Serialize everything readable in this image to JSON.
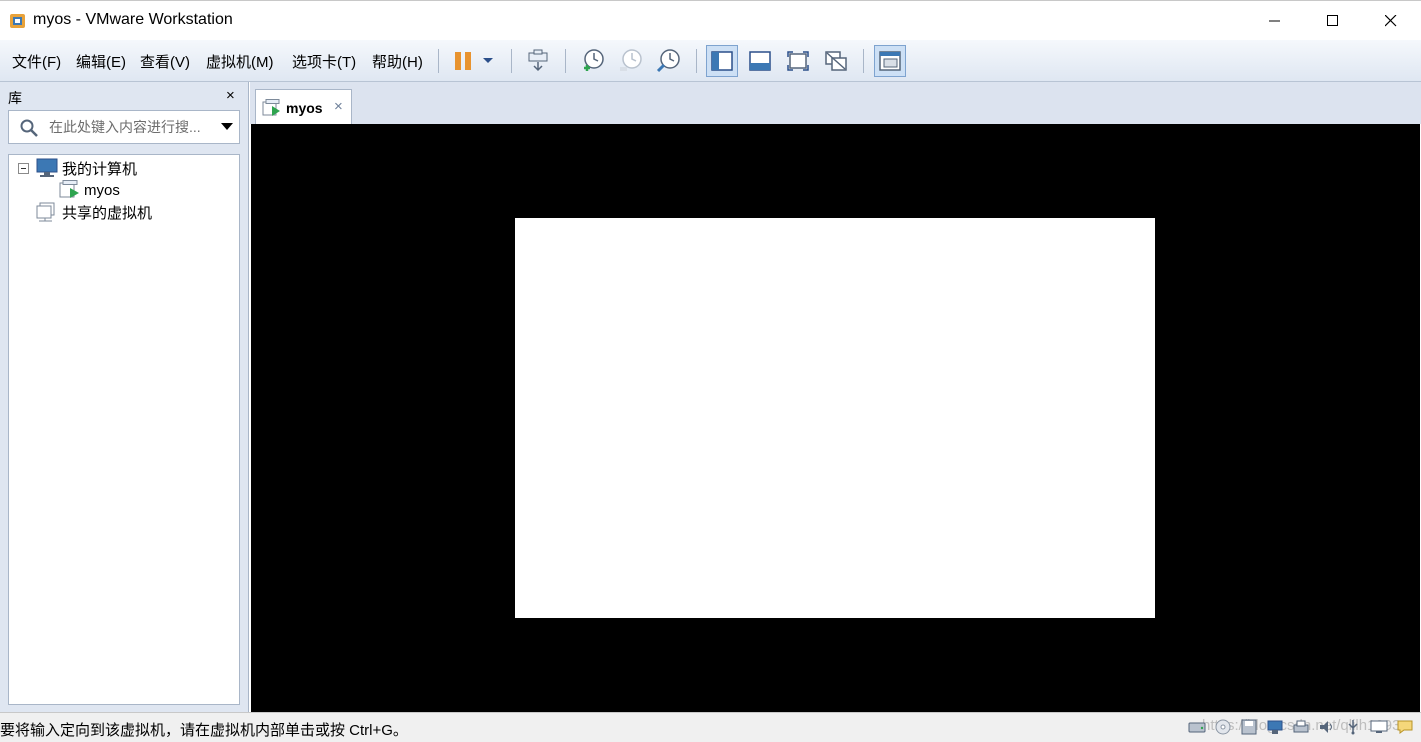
{
  "window": {
    "title": "myos - VMware Workstation",
    "minimize_icon": "minimize-icon",
    "maximize_icon": "maximize-icon",
    "close_icon": "close-icon"
  },
  "menu": {
    "items": [
      "文件(F)",
      "编辑(E)",
      "查看(V)",
      "虚拟机(M)",
      "选项卡(T)",
      "帮助(H)"
    ]
  },
  "toolbar": {
    "icons": [
      "pause-icon",
      "dropdown-arrow-icon",
      "send-ctrl-alt-del-icon",
      "take-snapshot-icon",
      "revert-snapshot-icon",
      "snapshot-manager-icon",
      "show-library-icon",
      "show-thumbnail-icon",
      "full-screen-icon",
      "unity-icon",
      "console-view-icon"
    ]
  },
  "library": {
    "title": "库",
    "close": "×",
    "search": {
      "placeholder": "在此处键入内容进行搜..."
    },
    "tree": [
      {
        "label": "我的计算机",
        "icon": "computer-icon"
      },
      {
        "label": "myos",
        "icon": "vm-running-icon"
      },
      {
        "label": "共享的虚拟机",
        "icon": "shared-vm-icon"
      }
    ]
  },
  "tab": {
    "label": "myos",
    "close": "×"
  },
  "status": {
    "message": "要将输入定向到该虚拟机，请在虚拟机内部单击或按 Ctrl+G。",
    "watermark": "https://blog.csdn.net/qlilh1993"
  },
  "colors": {
    "accent": "#3c78b4",
    "pause": "#e8932f",
    "play": "#2ea44f",
    "vm_background": "#000000",
    "vm_display": "#ffffff"
  }
}
